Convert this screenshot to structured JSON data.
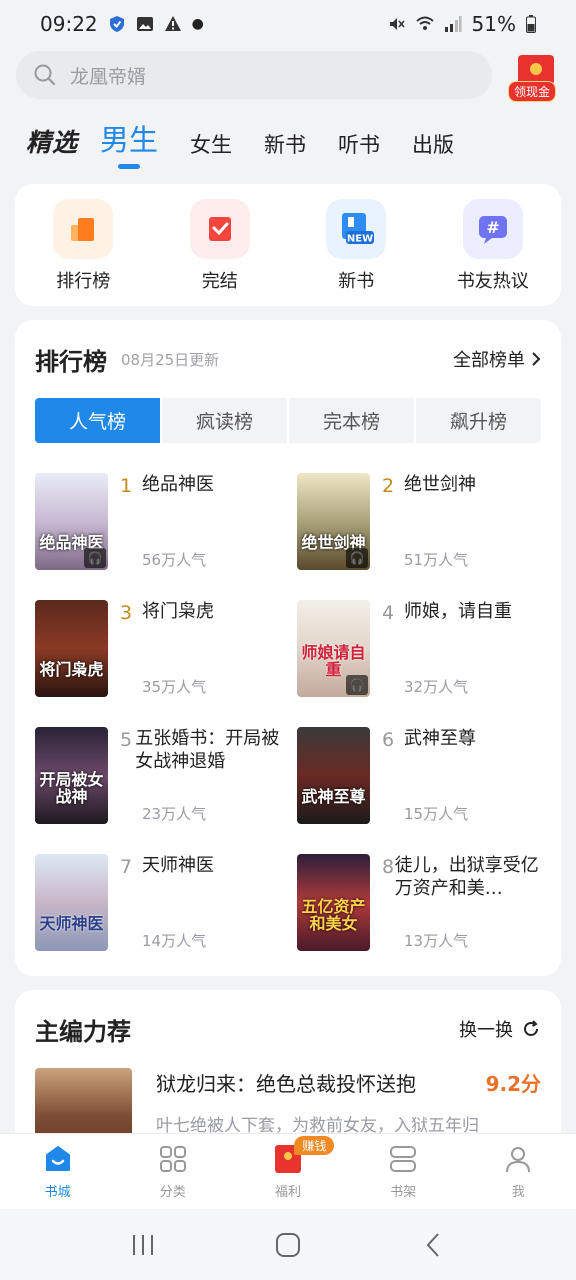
{
  "status": {
    "time": "09:22",
    "battery": "51%"
  },
  "search": {
    "placeholder": "龙凰帝婿",
    "reward_label": "领现金"
  },
  "category_tabs": [
    {
      "label": "精选"
    },
    {
      "label": "男生"
    },
    {
      "label": "女生"
    },
    {
      "label": "新书"
    },
    {
      "label": "听书"
    },
    {
      "label": "出版"
    }
  ],
  "quick_entries": [
    {
      "label": "排行榜",
      "icon": "ranking-icon",
      "bg": "#fff1e4"
    },
    {
      "label": "完结",
      "icon": "finished-icon",
      "bg": "#ffecec"
    },
    {
      "label": "新书",
      "icon": "new-book-icon",
      "bg": "#e8f3ff"
    },
    {
      "label": "书友热议",
      "icon": "discussion-icon",
      "bg": "#ecedff"
    }
  ],
  "ranking": {
    "title": "排行榜",
    "updated": "08月25日更新",
    "all_label": "全部榜单",
    "tabs": [
      {
        "label": "人气榜"
      },
      {
        "label": "疯读榜"
      },
      {
        "label": "完本榜"
      },
      {
        "label": "飙升榜"
      }
    ],
    "items": [
      {
        "rank": "1",
        "title": "绝品神医",
        "popularity": "56万人气",
        "cover_text": "绝品神医",
        "cover_bg": "linear-gradient(180deg,#e9ecf6,#c8b9d3 50%,#7d6a86)"
      },
      {
        "rank": "2",
        "title": "绝世剑神",
        "popularity": "51万人气",
        "cover_text": "绝世剑神",
        "cover_bg": "linear-gradient(180deg,#f1e6c5,#a9a37a 50%,#5a4a2c)"
      },
      {
        "rank": "3",
        "title": "将门枭虎",
        "popularity": "35万人气",
        "cover_text": "将门枭虎",
        "cover_bg": "linear-gradient(180deg,#5c2a1d,#8a3a25 50%,#2a1510)"
      },
      {
        "rank": "4",
        "title": "师娘，请自重",
        "popularity": "32万人气",
        "cover_text": "师娘请自重",
        "cover_bg": "linear-gradient(180deg,#f3efe9,#e2d5cb 50%,#c3a99b)"
      },
      {
        "rank": "5",
        "title": "五张婚书：开局被女战神退婚",
        "popularity": "23万人气",
        "cover_text": "开局被女战神",
        "cover_bg": "linear-gradient(180deg,#2a2236,#6b4a6a 50%,#1f1820)"
      },
      {
        "rank": "6",
        "title": "武神至尊",
        "popularity": "15万人气",
        "cover_text": "武神至尊",
        "cover_bg": "linear-gradient(180deg,#3a3a3a,#6b2a24 50%,#1a1a1a)"
      },
      {
        "rank": "7",
        "title": "天师神医",
        "popularity": "14万人气",
        "cover_text": "天师神医",
        "cover_bg": "linear-gradient(180deg,#dfe8f4,#c7b6c8 50%,#8d98b6)"
      },
      {
        "rank": "8",
        "title": "徒儿，出狱享受亿万资产和美…",
        "popularity": "13万人气",
        "cover_text": "五亿资产和美女",
        "cover_bg": "linear-gradient(180deg,#2c1f3a,#b03a3a 50%,#4a1a2a)"
      }
    ]
  },
  "editor_pick": {
    "title": "主编力荐",
    "refresh_label": "换一换",
    "book": {
      "title": "狱龙归来：绝色总裁投怀送抱",
      "score": "9.2分",
      "desc": "叶七绝被人下套，为救前女友，入狱五年归"
    }
  },
  "bottom_nav": [
    {
      "label": "书城",
      "icon": "bookstore-icon",
      "active": true
    },
    {
      "label": "分类",
      "icon": "category-icon",
      "active": false
    },
    {
      "label": "福利",
      "icon": "welfare-icon",
      "active": false,
      "badge": "赚钱"
    },
    {
      "label": "书架",
      "icon": "bookshelf-icon",
      "active": false
    },
    {
      "label": "我",
      "icon": "profile-icon",
      "active": false
    }
  ],
  "colors": {
    "accent": "#1f88e8",
    "gold_rank": "#c28a1b",
    "score": "#e8722a"
  }
}
